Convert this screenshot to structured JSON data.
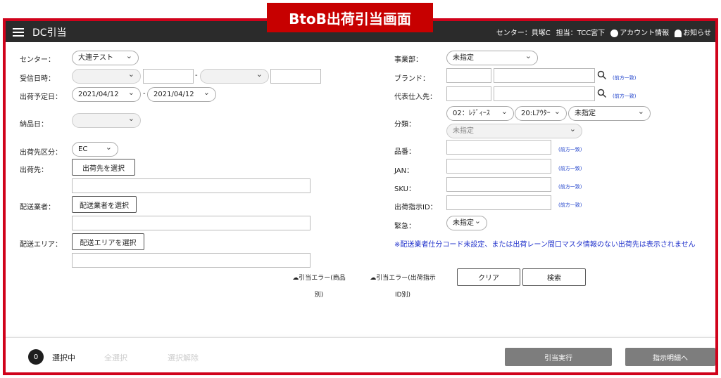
{
  "banner": "BtoB出荷引当画面",
  "header": {
    "title": "DC引当",
    "center": "センター：貝塚C",
    "person": "担当：TCC宮下",
    "account": "アカウント情報",
    "notice": "お知らせ"
  },
  "left": {
    "center_label": "センター：",
    "center_value": "大連テスト",
    "received_label": "受信日時：",
    "dash": "-",
    "ship_date_label": "出荷予定日：",
    "ship_date_from": "2021/04/12",
    "ship_date_to": "2021/04/12",
    "delivery_label": "納品日：",
    "dest_type_label": "出荷先区分：",
    "dest_type_value": "EC",
    "dest_label": "出荷先：",
    "dest_button": "出荷先を選択",
    "carrier_label": "配送業者：",
    "carrier_button": "配送業者を選択",
    "area_label": "配送エリア：",
    "area_button": "配送エリアを選択"
  },
  "right": {
    "division_label": "事業部：",
    "division_value": "未指定",
    "brand_label": "ブランド：",
    "supplier_label": "代表仕入先：",
    "prefix_hint": "(前方一致)",
    "category_label": "分類：",
    "cat1": "02：ﾚﾃﾞｨｰｽ",
    "cat2": "20:Lｱｳﾀｰ",
    "cat3": "未指定",
    "cat4": "未指定",
    "item_label": "品番：",
    "jan_label": "JAN：",
    "sku_label": "SKU：",
    "instr_label": "出荷指示ID：",
    "urgent_label": "緊急：",
    "urgent_value": "未指定",
    "notice": "※配送業者仕分コード未設定、または出荷レーン間口マスタ情報のない出荷先は表示されません"
  },
  "actions": {
    "dl1_line1": "引当エラー(商品",
    "dl1_line2": "別)",
    "dl2_line1": "引当エラー(出荷指示",
    "dl2_line2": "ID別)",
    "clear": "クリア",
    "search": "検索"
  },
  "footer": {
    "count": "0",
    "selected": "選択中",
    "select_all": "全選択",
    "deselect": "選択解除",
    "execute": "引当実行",
    "to_detail": "指示明細へ"
  }
}
